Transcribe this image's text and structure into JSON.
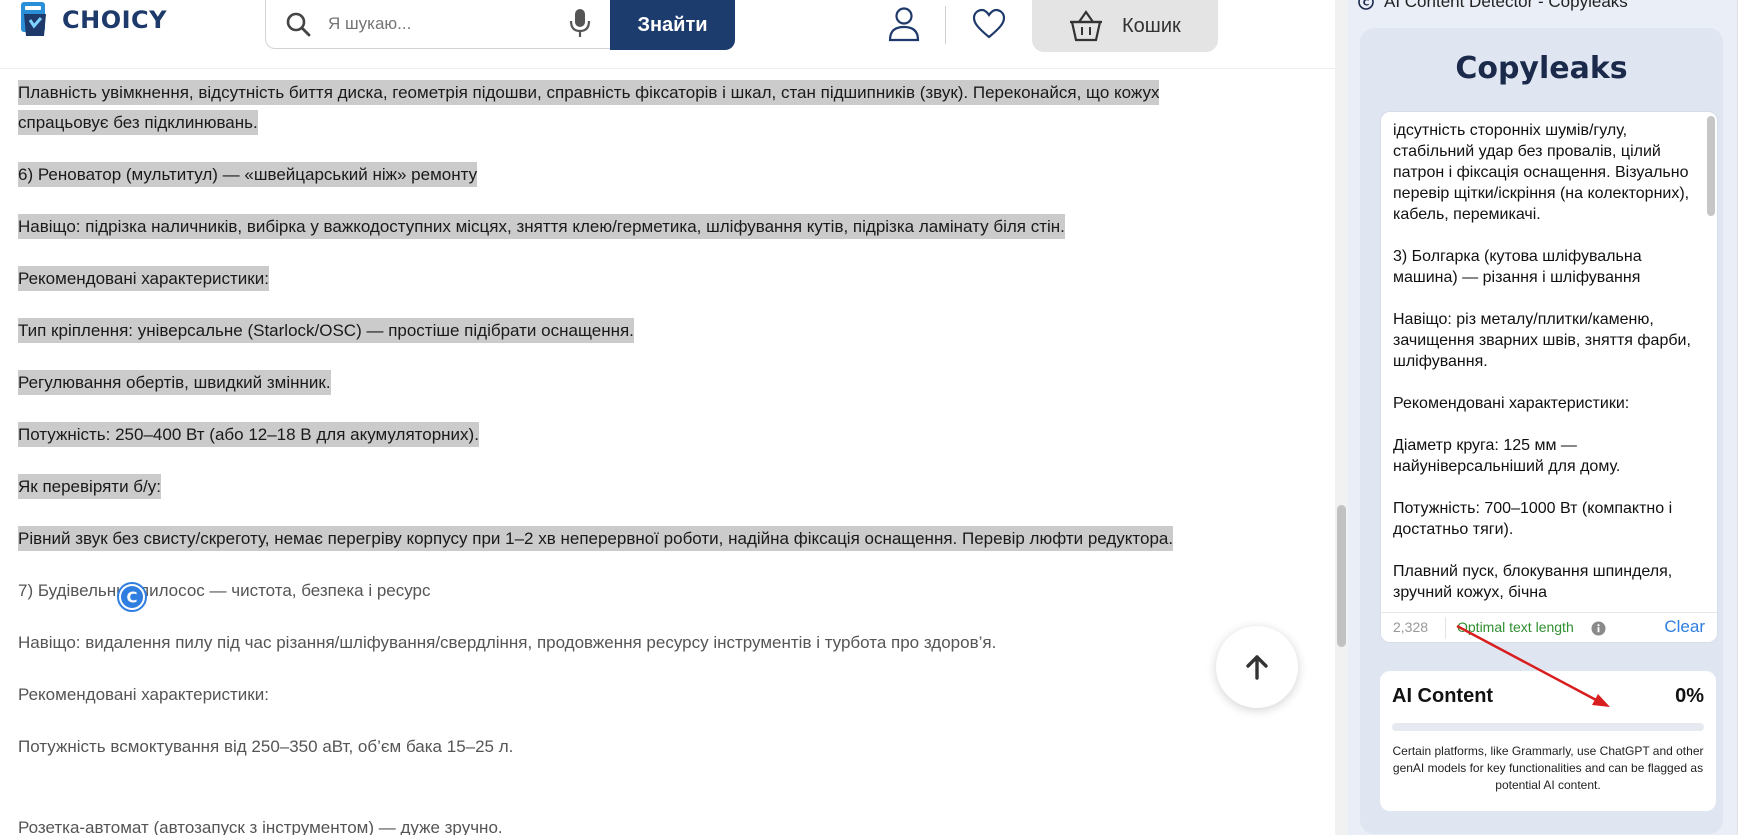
{
  "header": {
    "logo_text": "CHOICY",
    "search_placeholder": "Я шукаю...",
    "search_button": "Знайти",
    "cart_label": "Кошик"
  },
  "content": {
    "paragraphs": [
      {
        "text": "Плавність увімкнення, відсутність биття диска, геометрія підошви, справність фіксаторів і шкал, стан підшипників (звук). Переконайся, що кожух спрацьовує без підклинювань.",
        "highlighted": true
      },
      {
        "text": "6) Реноватор (мультитул) — «швейцарський ніж» ремонту",
        "highlighted": true
      },
      {
        "text": "Навіщо: підрізка наличників, вибірка у важкодоступних місцях, зняття клею/герметика, шліфування кутів, підрізка ламінату біля стін.",
        "highlighted": true
      },
      {
        "text": "Рекомендовані характеристики:",
        "highlighted": true
      },
      {
        "text": "Тип кріплення: універсальне (Starlock/OSC) — простіше підібрати оснащення.",
        "highlighted": true
      },
      {
        "text": "Регулювання обертів, швидкий змінник.",
        "highlighted": true
      },
      {
        "text": "Потужність: 250–400 Вт (або 12–18 В для акумуляторних).",
        "highlighted": true
      },
      {
        "text": "Як перевіряти б/у:",
        "highlighted": true
      },
      {
        "text": "Рівний звук без свисту/скреготу, немає перегріву корпусу при 1–2 хв неперервної роботи, надійна фіксація оснащення. Перевір люфти редуктора.",
        "highlighted": true
      },
      {
        "text": "7) Будівельний пилосос — чистота, безпека і ресурс",
        "highlighted": false
      },
      {
        "text": "Навіщо: видалення пилу під час різання/шліфування/свердління, продовження ресурсу інструментів і турбота про здоров’я.",
        "highlighted": false
      },
      {
        "text": "Рекомендовані характеристики:",
        "highlighted": false
      },
      {
        "text": "Потужність всмоктування від 250–350 аВт, об’єм бака 15–25 л.",
        "highlighted": false
      }
    ],
    "cut_line": "Розетка-автомат (автозапуск з інструментом) — дуже зручно."
  },
  "panel": {
    "title": "AI Content Detector - Copyleaks",
    "logo_text": "Copyleaks",
    "editor_text": "ідсутність сторонніх шумів/гулу, стабільний удар без провалів, цілий патрон і фіксація оснащення. Візуально перевір щітки/іскріння (на колекторних), кабель, перемикачі.\n\n3) Болгарка (кутова шліфувальна машина) — різання і шліфування\n\nНавіщо: різ металу/плитки/каменю, зачищення зварних швів, зняття фарби, шліфування.\n\nРекомендовані характеристики:\n\nДіаметр круга: 125 мм — найуніверсальніший для дому.\n\nПотужність: 700–1000 Вт (компактно і достатньо тяги).\n\nПлавний пуск, блокування шпинделя, зручний кожух, бічна",
    "char_count": "2,328",
    "length_status": "Optimal text length",
    "clear_label": "Clear",
    "ai_title": "AI Content",
    "ai_percent": "0%",
    "ai_percent_value": 0,
    "ai_note": "Certain platforms, like Grammarly, use ChatGPT and other genAI models for key functionalities and can be flagged as potential AI content."
  },
  "colors": {
    "brand_navy": "#1d3c6e",
    "highlight_gray": "#cbcbcb",
    "status_green": "#2f8f2f",
    "link_blue": "#2f7ee0",
    "annotation_red": "#d81e1e"
  },
  "icons": [
    "search-icon",
    "mic-icon",
    "user-icon",
    "heart-icon",
    "cart-icon",
    "copyleaks-badge-icon",
    "arrow-up-icon",
    "info-icon"
  ]
}
